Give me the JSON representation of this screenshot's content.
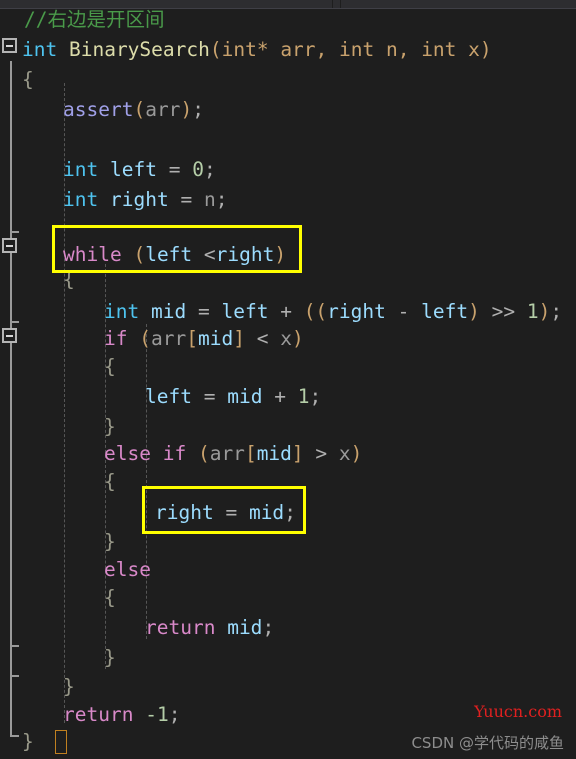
{
  "window": {
    "top_bar_present": true
  },
  "editor": {
    "background_color": "#1e1e1e",
    "language": "C",
    "highlight_color": "#ffff00",
    "lines": [
      {
        "indent": 0,
        "text": "//右边是开区间"
      },
      {
        "indent": 0,
        "text": "int BinarySearch(int* arr, int n, int x)"
      },
      {
        "indent": 0,
        "text": "{"
      },
      {
        "indent": 1,
        "text": "assert(arr);"
      },
      {
        "indent": 0,
        "text": ""
      },
      {
        "indent": 1,
        "text": "int left = 0;"
      },
      {
        "indent": 1,
        "text": "int right = n;"
      },
      {
        "indent": 0,
        "text": ""
      },
      {
        "indent": 1,
        "text": "while (left <right)"
      },
      {
        "indent": 1,
        "text": "{"
      },
      {
        "indent": 2,
        "text": "int mid = left + ((right - left) >> 1);"
      },
      {
        "indent": 2,
        "text": "if (arr[mid] < x)"
      },
      {
        "indent": 2,
        "text": "{"
      },
      {
        "indent": 3,
        "text": "left = mid + 1;"
      },
      {
        "indent": 2,
        "text": "}"
      },
      {
        "indent": 2,
        "text": "else if (arr[mid] > x)"
      },
      {
        "indent": 2,
        "text": "{"
      },
      {
        "indent": 3,
        "text": "right = mid;"
      },
      {
        "indent": 2,
        "text": "}"
      },
      {
        "indent": 2,
        "text": "else"
      },
      {
        "indent": 2,
        "text": "{"
      },
      {
        "indent": 3,
        "text": "return mid;"
      },
      {
        "indent": 2,
        "text": "}"
      },
      {
        "indent": 1,
        "text": "}"
      },
      {
        "indent": 1,
        "text": "return -1;"
      },
      {
        "indent": 0,
        "text": "}"
      }
    ],
    "comment_line": "//右边是开区间",
    "signature": {
      "return_type": "int",
      "name": "BinarySearch",
      "params": "(int* arr, int n, int x)"
    },
    "tokens": {
      "kw_int": "int",
      "kw_while": "while",
      "kw_if": "if",
      "kw_else": "else",
      "kw_return": "return",
      "fn_name": "BinarySearch",
      "macro_assert": "assert",
      "var_arr": "arr",
      "var_n": "n",
      "var_x": "x",
      "var_left": "left",
      "var_right": "right",
      "var_mid": "mid",
      "num_zero": "0",
      "num_one": "1",
      "num_neg_one": "-1"
    },
    "highlights": [
      {
        "label": "while-condition-box",
        "code": "while (left <right)"
      },
      {
        "label": "right-assign-box",
        "code": "right = mid;"
      }
    ],
    "fold_markers": [
      {
        "label": "fold-function",
        "state": "expanded"
      },
      {
        "label": "fold-while",
        "state": "expanded"
      },
      {
        "label": "fold-if",
        "state": "expanded"
      }
    ]
  },
  "watermarks": {
    "site": "Yuucn.com",
    "site_color": "#e02020",
    "csdn": "CSDN @学代码的咸鱼",
    "csdn_color": "#8d8d8d"
  }
}
